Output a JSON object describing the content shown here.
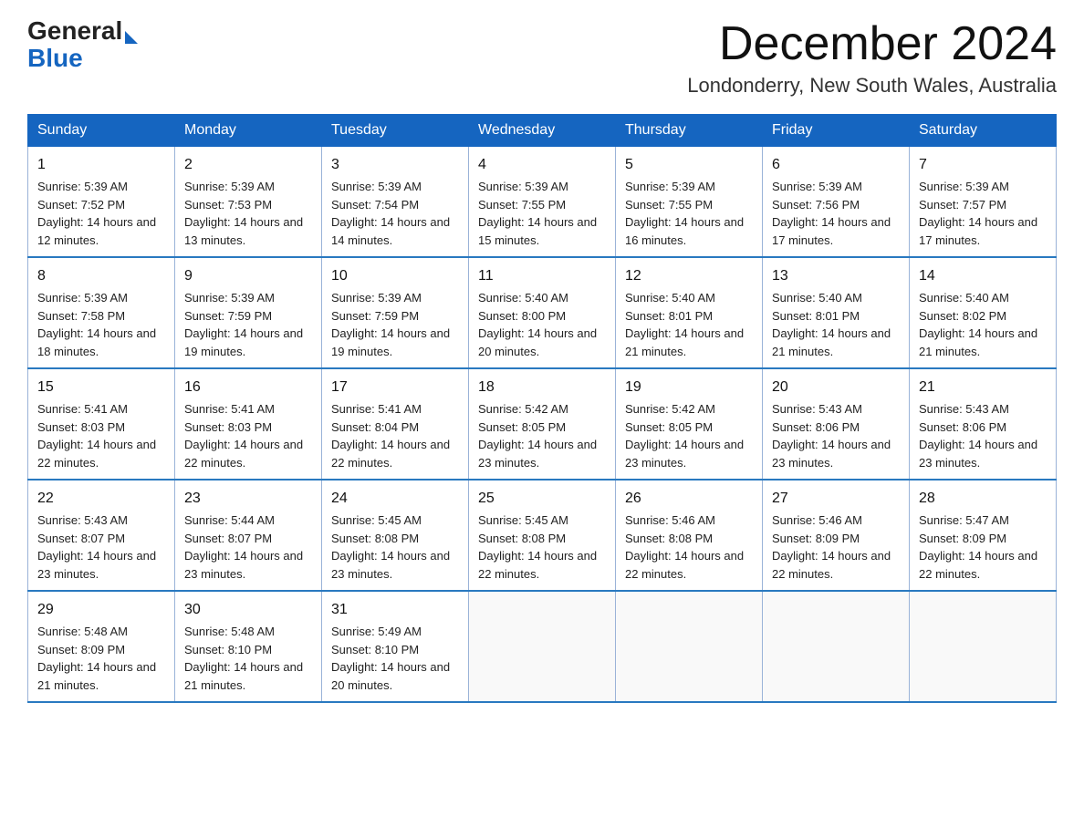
{
  "header": {
    "logo_general": "General",
    "logo_blue": "Blue",
    "month_title": "December 2024",
    "location": "Londonderry, New South Wales, Australia"
  },
  "days_of_week": [
    "Sunday",
    "Monday",
    "Tuesday",
    "Wednesday",
    "Thursday",
    "Friday",
    "Saturday"
  ],
  "weeks": [
    [
      {
        "day": "1",
        "sunrise": "5:39 AM",
        "sunset": "7:52 PM",
        "daylight": "14 hours and 12 minutes."
      },
      {
        "day": "2",
        "sunrise": "5:39 AM",
        "sunset": "7:53 PM",
        "daylight": "14 hours and 13 minutes."
      },
      {
        "day": "3",
        "sunrise": "5:39 AM",
        "sunset": "7:54 PM",
        "daylight": "14 hours and 14 minutes."
      },
      {
        "day": "4",
        "sunrise": "5:39 AM",
        "sunset": "7:55 PM",
        "daylight": "14 hours and 15 minutes."
      },
      {
        "day": "5",
        "sunrise": "5:39 AM",
        "sunset": "7:55 PM",
        "daylight": "14 hours and 16 minutes."
      },
      {
        "day": "6",
        "sunrise": "5:39 AM",
        "sunset": "7:56 PM",
        "daylight": "14 hours and 17 minutes."
      },
      {
        "day": "7",
        "sunrise": "5:39 AM",
        "sunset": "7:57 PM",
        "daylight": "14 hours and 17 minutes."
      }
    ],
    [
      {
        "day": "8",
        "sunrise": "5:39 AM",
        "sunset": "7:58 PM",
        "daylight": "14 hours and 18 minutes."
      },
      {
        "day": "9",
        "sunrise": "5:39 AM",
        "sunset": "7:59 PM",
        "daylight": "14 hours and 19 minutes."
      },
      {
        "day": "10",
        "sunrise": "5:39 AM",
        "sunset": "7:59 PM",
        "daylight": "14 hours and 19 minutes."
      },
      {
        "day": "11",
        "sunrise": "5:40 AM",
        "sunset": "8:00 PM",
        "daylight": "14 hours and 20 minutes."
      },
      {
        "day": "12",
        "sunrise": "5:40 AM",
        "sunset": "8:01 PM",
        "daylight": "14 hours and 21 minutes."
      },
      {
        "day": "13",
        "sunrise": "5:40 AM",
        "sunset": "8:01 PM",
        "daylight": "14 hours and 21 minutes."
      },
      {
        "day": "14",
        "sunrise": "5:40 AM",
        "sunset": "8:02 PM",
        "daylight": "14 hours and 21 minutes."
      }
    ],
    [
      {
        "day": "15",
        "sunrise": "5:41 AM",
        "sunset": "8:03 PM",
        "daylight": "14 hours and 22 minutes."
      },
      {
        "day": "16",
        "sunrise": "5:41 AM",
        "sunset": "8:03 PM",
        "daylight": "14 hours and 22 minutes."
      },
      {
        "day": "17",
        "sunrise": "5:41 AM",
        "sunset": "8:04 PM",
        "daylight": "14 hours and 22 minutes."
      },
      {
        "day": "18",
        "sunrise": "5:42 AM",
        "sunset": "8:05 PM",
        "daylight": "14 hours and 23 minutes."
      },
      {
        "day": "19",
        "sunrise": "5:42 AM",
        "sunset": "8:05 PM",
        "daylight": "14 hours and 23 minutes."
      },
      {
        "day": "20",
        "sunrise": "5:43 AM",
        "sunset": "8:06 PM",
        "daylight": "14 hours and 23 minutes."
      },
      {
        "day": "21",
        "sunrise": "5:43 AM",
        "sunset": "8:06 PM",
        "daylight": "14 hours and 23 minutes."
      }
    ],
    [
      {
        "day": "22",
        "sunrise": "5:43 AM",
        "sunset": "8:07 PM",
        "daylight": "14 hours and 23 minutes."
      },
      {
        "day": "23",
        "sunrise": "5:44 AM",
        "sunset": "8:07 PM",
        "daylight": "14 hours and 23 minutes."
      },
      {
        "day": "24",
        "sunrise": "5:45 AM",
        "sunset": "8:08 PM",
        "daylight": "14 hours and 23 minutes."
      },
      {
        "day": "25",
        "sunrise": "5:45 AM",
        "sunset": "8:08 PM",
        "daylight": "14 hours and 22 minutes."
      },
      {
        "day": "26",
        "sunrise": "5:46 AM",
        "sunset": "8:08 PM",
        "daylight": "14 hours and 22 minutes."
      },
      {
        "day": "27",
        "sunrise": "5:46 AM",
        "sunset": "8:09 PM",
        "daylight": "14 hours and 22 minutes."
      },
      {
        "day": "28",
        "sunrise": "5:47 AM",
        "sunset": "8:09 PM",
        "daylight": "14 hours and 22 minutes."
      }
    ],
    [
      {
        "day": "29",
        "sunrise": "5:48 AM",
        "sunset": "8:09 PM",
        "daylight": "14 hours and 21 minutes."
      },
      {
        "day": "30",
        "sunrise": "5:48 AM",
        "sunset": "8:10 PM",
        "daylight": "14 hours and 21 minutes."
      },
      {
        "day": "31",
        "sunrise": "5:49 AM",
        "sunset": "8:10 PM",
        "daylight": "14 hours and 20 minutes."
      },
      null,
      null,
      null,
      null
    ]
  ],
  "labels": {
    "sunrise": "Sunrise:",
    "sunset": "Sunset:",
    "daylight": "Daylight:"
  }
}
